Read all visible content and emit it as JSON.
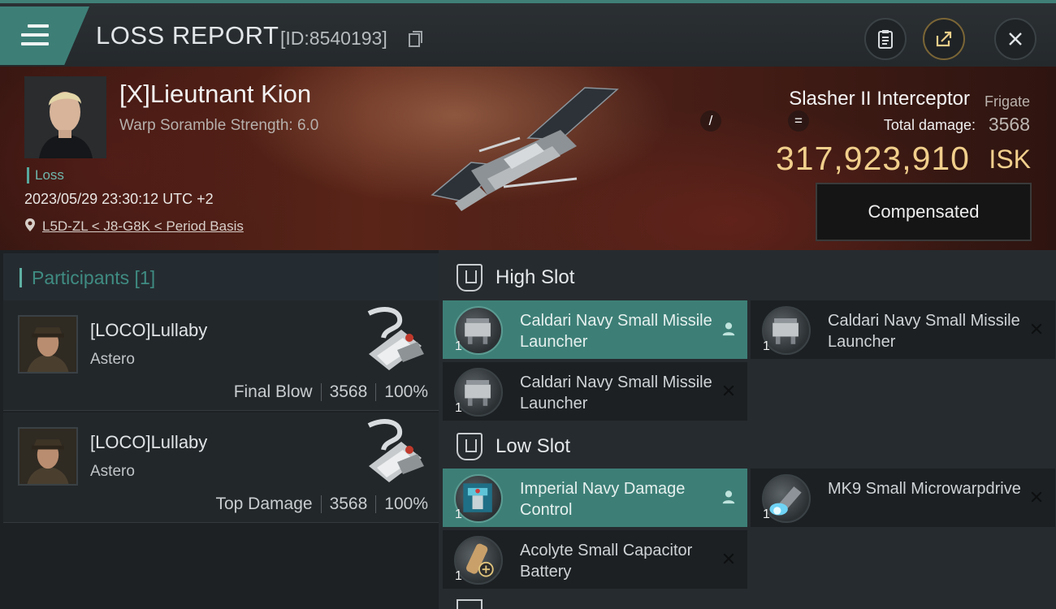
{
  "header": {
    "title": "LOSS REPORT",
    "report_id": "[ID:8540193]"
  },
  "victim": {
    "name": "[X]Lieutnant Kion",
    "subtitle": "Warp Soramble Strength: 6.0",
    "tag": "Loss",
    "datetime": "2023/05/29 23:30:12 UTC +2",
    "location": "L5D-ZL < J8-G8K < Period Basis"
  },
  "ship": {
    "name": "Slasher II Interceptor",
    "class": "Frigate",
    "damage_label": "Total damage:",
    "damage_value": "3568",
    "isk_value": "317,923,910",
    "isk_unit": "ISK",
    "markers": [
      "/",
      "="
    ]
  },
  "actions": {
    "compensated": "Compensated"
  },
  "participants": {
    "title": "Participants [1]",
    "rows": [
      {
        "name": "[LOCO]Lullaby",
        "ship": "Astero",
        "role": "Final Blow",
        "damage": "3568",
        "percent": "100%"
      },
      {
        "name": "[LOCO]Lullaby",
        "ship": "Astero",
        "role": "Top Damage",
        "damage": "3568",
        "percent": "100%"
      }
    ]
  },
  "fitting": {
    "high_slot": {
      "label": "High Slot",
      "modules": [
        {
          "name": "Caldari Navy Small Missile Launcher",
          "qty": "1",
          "status": "user-icon"
        },
        {
          "name": "Caldari Navy Small Missile Launcher",
          "qty": "1",
          "status": "close-icon"
        },
        {
          "name": "Caldari Navy Small Missile Launcher",
          "qty": "1",
          "status": "close-icon"
        }
      ]
    },
    "low_slot": {
      "label": "Low Slot",
      "modules": [
        {
          "name": "Imperial Navy Damage Control",
          "qty": "1",
          "status": "user-icon"
        },
        {
          "name": "MK9 Small Microwarpdrive",
          "qty": "1",
          "status": "close-icon"
        },
        {
          "name": "Acolyte Small Capacitor Battery",
          "qty": "1",
          "status": "close-icon"
        }
      ]
    }
  },
  "colors": {
    "accent": "#3d7f77",
    "isk": "#f1cf8c"
  }
}
